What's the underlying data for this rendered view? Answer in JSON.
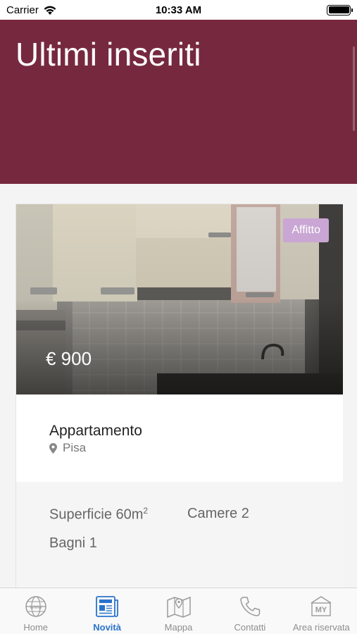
{
  "status_bar": {
    "carrier": "Carrier",
    "time": "10:33 AM"
  },
  "header": {
    "title": "Ultimi inseriti",
    "bg_color": "#76293e"
  },
  "listing": {
    "badge": "Affitto",
    "price": "€ 900",
    "type": "Appartamento",
    "location": "Pisa",
    "surface_label": "Superficie 60m",
    "surface_sup": "2",
    "rooms": "Camere 2",
    "bathrooms": "Bagni 1"
  },
  "tabs": [
    {
      "label": "Home",
      "icon": "globe-icon",
      "active": false
    },
    {
      "label": "Novità",
      "icon": "newspaper-icon",
      "active": true
    },
    {
      "label": "Mappa",
      "icon": "map-icon",
      "active": false
    },
    {
      "label": "Contatti",
      "icon": "phone-icon",
      "active": false
    },
    {
      "label": "Area riservata",
      "icon": "my-area-icon",
      "active": false
    }
  ],
  "colors": {
    "accent": "#2a73cc",
    "badge": "#c9a6d3"
  }
}
